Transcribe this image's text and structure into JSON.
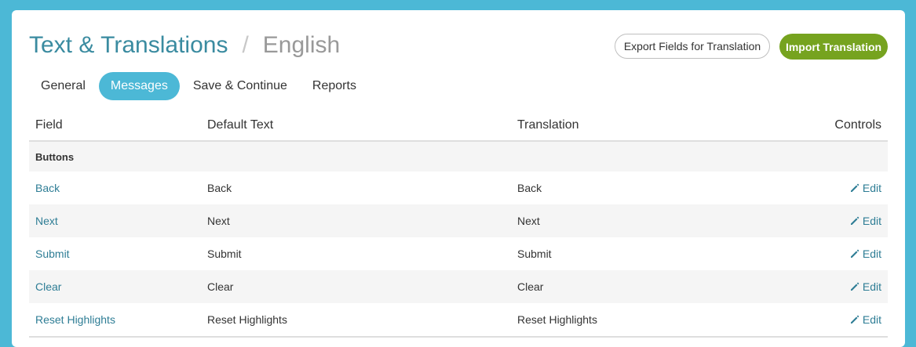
{
  "header": {
    "title": "Text & Translations",
    "separator": "/",
    "language": "English",
    "export_label": "Export Fields for Translation",
    "import_label": "Import Translation"
  },
  "tabs": [
    {
      "label": "General",
      "active": false
    },
    {
      "label": "Messages",
      "active": true
    },
    {
      "label": "Save & Continue",
      "active": false
    },
    {
      "label": "Reports",
      "active": false
    }
  ],
  "table": {
    "headers": {
      "field": "Field",
      "default_text": "Default Text",
      "translation": "Translation",
      "controls": "Controls"
    },
    "group": "Buttons",
    "rows": [
      {
        "field": "Back",
        "default_text": "Back",
        "translation": "Back",
        "control": "Edit"
      },
      {
        "field": "Next",
        "default_text": "Next",
        "translation": "Next",
        "control": "Edit"
      },
      {
        "field": "Submit",
        "default_text": "Submit",
        "translation": "Submit",
        "control": "Edit"
      },
      {
        "field": "Clear",
        "default_text": "Clear",
        "translation": "Clear",
        "control": "Edit"
      },
      {
        "field": "Reset Highlights",
        "default_text": "Reset Highlights",
        "translation": "Reset Highlights",
        "control": "Edit"
      }
    ]
  },
  "icons": {
    "edit": "pencil-icon"
  },
  "colors": {
    "background": "#4cb8d6",
    "title": "#3a8ba0",
    "link": "#2e7d95",
    "import_button": "#76a31f",
    "active_tab": "#4cb8d6"
  }
}
